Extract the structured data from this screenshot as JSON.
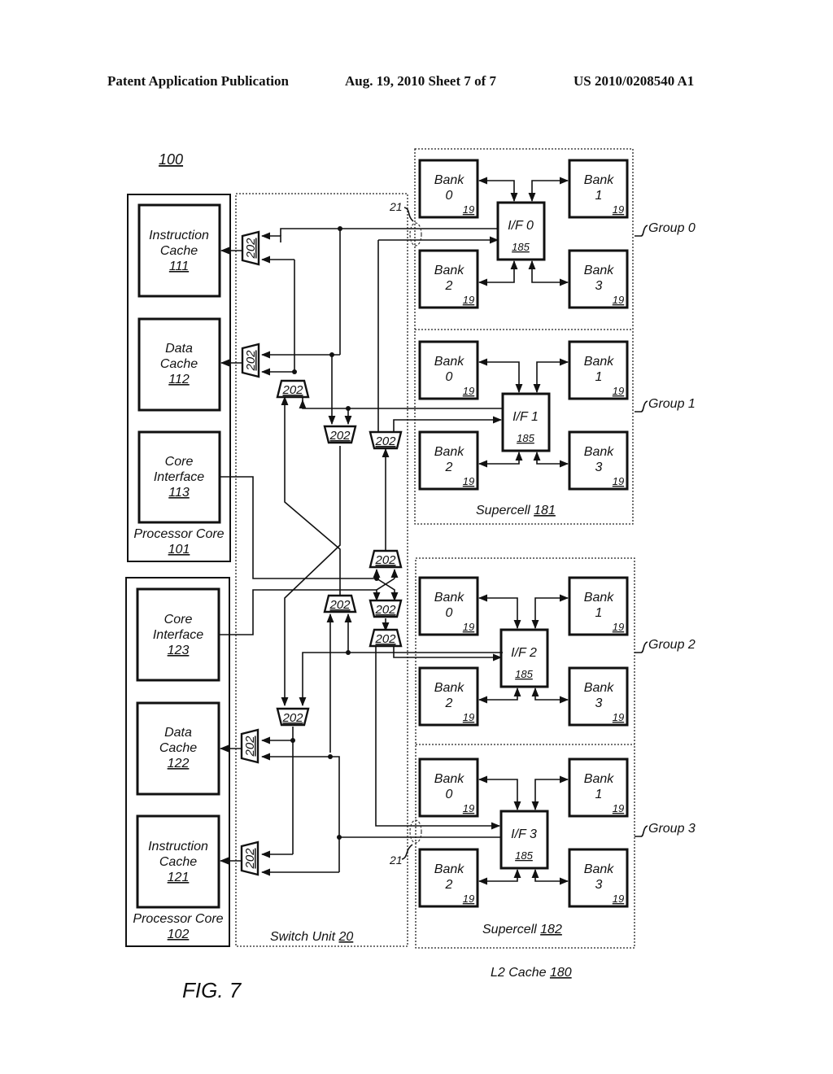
{
  "header": {
    "left": "Patent Application Publication",
    "middle": "Aug. 19, 2010  Sheet 7 of 7",
    "right": "US 2010/0208540 A1"
  },
  "figure": {
    "label": "FIG. 7",
    "system_ref": "100",
    "bus_ref": "21",
    "mux_ref": "202",
    "switch_unit": {
      "name": "Switch Unit",
      "ref": "20"
    },
    "l2_cache": {
      "name": "L2 Cache",
      "ref": "180"
    },
    "processor_cores": [
      {
        "name": "Processor Core",
        "ref": "101",
        "blocks": [
          {
            "line1": "Instruction",
            "line2": "Cache",
            "ref": "111"
          },
          {
            "line1": "Data",
            "line2": "Cache",
            "ref": "112"
          },
          {
            "line1": "Core",
            "line2": "Interface",
            "ref": "113"
          }
        ]
      },
      {
        "name": "Processor Core",
        "ref": "102",
        "blocks": [
          {
            "line1": "Core",
            "line2": "Interface",
            "ref": "123"
          },
          {
            "line1": "Data",
            "line2": "Cache",
            "ref": "122"
          },
          {
            "line1": "Instruction",
            "line2": "Cache",
            "ref": "121"
          }
        ]
      }
    ],
    "supercells": [
      {
        "name": "Supercell",
        "ref": "181"
      },
      {
        "name": "Supercell",
        "ref": "182"
      }
    ],
    "groups": [
      {
        "name": "Group 0",
        "interface": "I/F 0",
        "if_ref": "185",
        "banks": [
          {
            "label": "Bank",
            "num": "0",
            "ref": "19"
          },
          {
            "label": "Bank",
            "num": "1",
            "ref": "19"
          },
          {
            "label": "Bank",
            "num": "2",
            "ref": "19"
          },
          {
            "label": "Bank",
            "num": "3",
            "ref": "19"
          }
        ]
      },
      {
        "name": "Group 1",
        "interface": "I/F 1",
        "if_ref": "185",
        "banks": [
          {
            "label": "Bank",
            "num": "0",
            "ref": "19"
          },
          {
            "label": "Bank",
            "num": "1",
            "ref": "19"
          },
          {
            "label": "Bank",
            "num": "2",
            "ref": "19"
          },
          {
            "label": "Bank",
            "num": "3",
            "ref": "19"
          }
        ]
      },
      {
        "name": "Group 2",
        "interface": "I/F 2",
        "if_ref": "185",
        "banks": [
          {
            "label": "Bank",
            "num": "0",
            "ref": "19"
          },
          {
            "label": "Bank",
            "num": "1",
            "ref": "19"
          },
          {
            "label": "Bank",
            "num": "2",
            "ref": "19"
          },
          {
            "label": "Bank",
            "num": "3",
            "ref": "19"
          }
        ]
      },
      {
        "name": "Group 3",
        "interface": "I/F 3",
        "if_ref": "185",
        "banks": [
          {
            "label": "Bank",
            "num": "0",
            "ref": "19"
          },
          {
            "label": "Bank",
            "num": "1",
            "ref": "19"
          },
          {
            "label": "Bank",
            "num": "2",
            "ref": "19"
          },
          {
            "label": "Bank",
            "num": "3",
            "ref": "19"
          }
        ]
      }
    ]
  }
}
